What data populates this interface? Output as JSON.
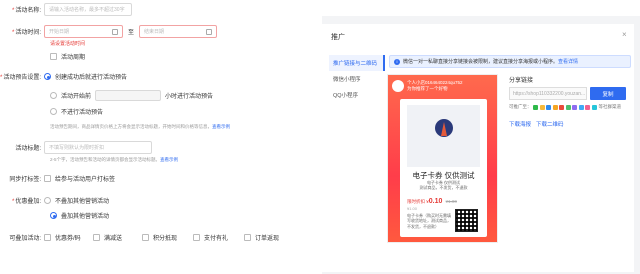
{
  "form": {
    "name": {
      "label": "活动名称:",
      "placeholder": "请输入活动名称，最多不超过30字"
    },
    "time": {
      "label": "活动时间:",
      "start_placeholder": "开始日期",
      "sep": "至",
      "end_placeholder": "结束日期",
      "error": "请设置活动时间",
      "cycle_label": "活动周期"
    },
    "preview": {
      "label": "活动预告设置:",
      "options": [
        "创建成功后就进行活动预告",
        "活动开始前",
        "不进行活动预告"
      ],
      "hours_suffix": "小时进行活动预告",
      "hint": "活动预告期间，商品详情页价格上方将会显示活动标题，开始时间和价格等信息，",
      "hint_link": "查看示例"
    },
    "tag": {
      "label": "活动标题:",
      "placeholder": "不填写则默认为限时折扣",
      "hint": "2-5个字，活动预告和活动的详情页都会显示活动标题。",
      "hint_link": "查看示例"
    },
    "sync": {
      "label": "同步打标签:",
      "option": "给参与活动用户打标签"
    },
    "stack": {
      "label": "优惠叠加:",
      "options": [
        "不叠加其他营销活动",
        "叠加其他营销活动"
      ]
    },
    "can_stack": {
      "label": "可叠加活动:",
      "options": [
        "优惠券/码",
        "满减送",
        "积分抵现",
        "支付有礼",
        "订单返现"
      ]
    }
  },
  "dialog": {
    "title": "推广",
    "close": "×",
    "tabs": [
      "推广链接与二维码",
      "微信小程序",
      "QQ小程序"
    ],
    "notice": "微信一对一私聊直接分享链接会被限制，建议直接分享海报或小程序。",
    "notice_link": "查看详情",
    "poster": {
      "shop_name": "个人小店0164640224qu752",
      "shop_sub": "为你推荐了一个好物",
      "item_title": "电子卡券 仅供测试",
      "sub_lines": [
        "电子卡券 仅供测试",
        "测试商品，不发货，不退款"
      ],
      "price_label": "限时折扣",
      "price_symbol": "¥",
      "price": "0.10",
      "original_price": "¥1.00",
      "old_price": "¥1.00",
      "desc": "电子卡券（购买时无需填写收货地址，测试商品，不发货，不退款）"
    },
    "share": {
      "title": "分享链接",
      "link_placeholder": "https://shop110332200.youzan...",
      "copy": "复制",
      "share_to_label": "可推广至：",
      "tail": "等社群渠道"
    },
    "download_poster": "下载海报",
    "download_qr": "下载二维码"
  },
  "colors": {
    "primary": "#2f6bf0",
    "danger": "#e53935",
    "poster": "#ff4a4a"
  }
}
